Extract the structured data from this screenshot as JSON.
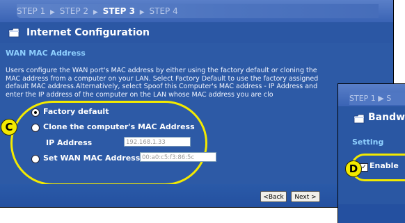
{
  "steps": [
    {
      "label": "STEP 1"
    },
    {
      "label": "STEP 2"
    },
    {
      "label": "STEP 3"
    },
    {
      "label": "STEP 4"
    }
  ],
  "step_separator": "▶",
  "title": "Internet Configuration",
  "section": "WAN MAC Address",
  "description_lines": [
    "Users configure the WAN port's MAC address by either using the factory default or cloning the",
    "MAC address from a computer on your LAN. Select Factory Default to use the factory assigned",
    "default MAC address.Alternatively, select Spoof this Computer's MAC address - IP Address and",
    "enter the IP address of the computer on the LAN whose MAC address you are clo"
  ],
  "options": {
    "factory_default": "Factory default",
    "clone": "Clone the computer's MAC Address",
    "ip_label": "IP Address",
    "ip_value": "192.168.1.33",
    "set_wan": "Set WAN MAC Address",
    "mac_value": "00:a0:c5:f3:86:5c"
  },
  "callouts": {
    "c": "C",
    "d": "D"
  },
  "buttons": {
    "back": "<Back",
    "next": "Next >"
  },
  "second_window": {
    "steps": "STEP 1 ▶ S",
    "title": "Bandw",
    "section": "Setting",
    "enable": "Enable",
    "check_mark": "✓"
  },
  "colors": {
    "accent": "#2d5aa6",
    "highlight": "#f3ea00",
    "section_text": "#8fd0ff"
  }
}
